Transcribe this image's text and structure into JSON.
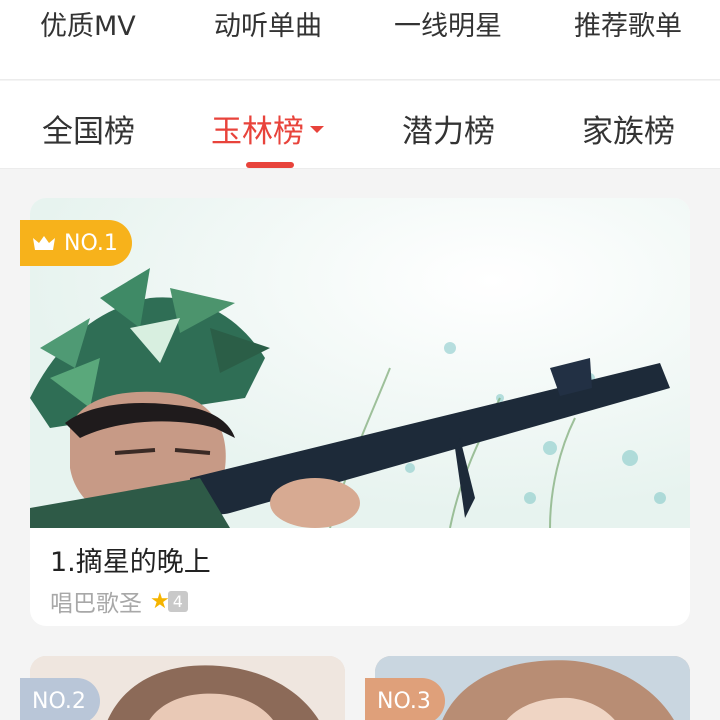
{
  "top_categories": [
    "优质MV",
    "动听单曲",
    "一线明星",
    "推荐歌单"
  ],
  "rank_tabs": {
    "items": [
      "全国榜",
      "玉林榜",
      "潜力榜",
      "家族榜"
    ],
    "active": "玉林榜"
  },
  "featured": {
    "badge": "NO.1",
    "title": "1.摘星的晚上",
    "singer": "唱巴歌圣",
    "level": "4"
  },
  "others": [
    {
      "badge": "NO.2"
    },
    {
      "badge": "NO.3"
    }
  ],
  "colors": {
    "accent": "#e8433b",
    "gold": "#f7b21b",
    "silver": "#b9c6d8",
    "bronze": "#dfa07a"
  }
}
